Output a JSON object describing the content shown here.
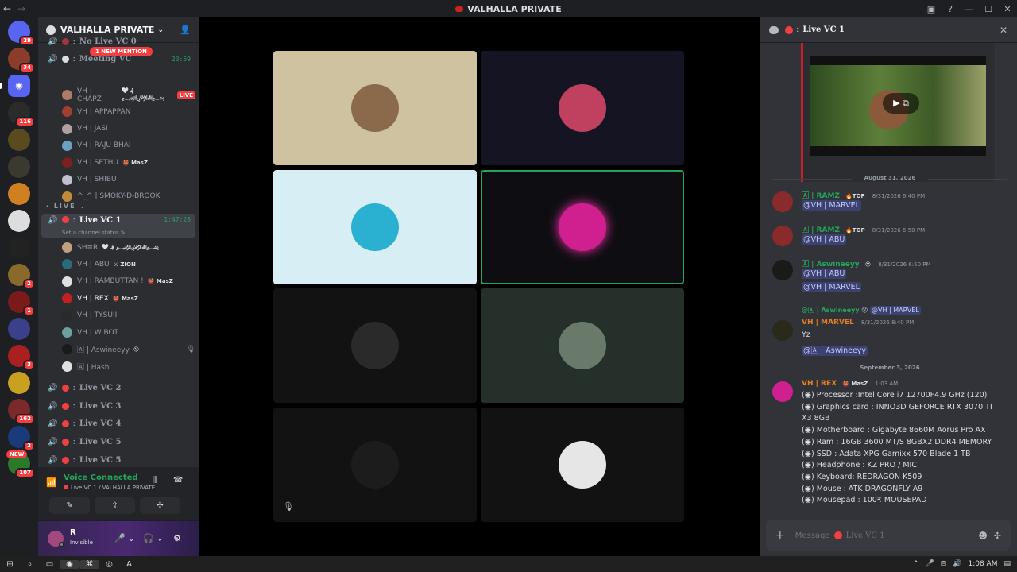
{
  "window": {
    "title": "VALHALLA PRIVATE",
    "back": "←",
    "forward": "→",
    "controls": [
      "▣",
      "?",
      "—",
      "☐",
      "✕"
    ]
  },
  "servers": [
    {
      "name": "discord-home",
      "badge": "29",
      "color": "#5865f2"
    },
    {
      "name": "server-1",
      "badge": "34",
      "color": "#8a3d2a"
    },
    {
      "name": "server-discord",
      "badge": "",
      "color": "#5865f2",
      "selected": true
    },
    {
      "name": "server-3",
      "badge": "116",
      "color": "#2b2b2b"
    },
    {
      "name": "server-4",
      "badge": "",
      "color": "#5a4a20"
    },
    {
      "name": "server-5",
      "badge": "",
      "color": "#3a3a30"
    },
    {
      "name": "server-6",
      "badge": "",
      "color": "#d08020"
    },
    {
      "name": "server-7",
      "badge": "",
      "color": "#ddd"
    },
    {
      "name": "server-8",
      "badge": "",
      "color": "#222"
    },
    {
      "name": "server-9",
      "badge": "2",
      "color": "#8a6a2a"
    },
    {
      "name": "server-10",
      "badge": "1",
      "color": "#7a1a1a"
    },
    {
      "name": "folder",
      "badge": "",
      "color": "#3c3f8a"
    },
    {
      "name": "server-12",
      "badge": "3",
      "color": "#aa2020"
    },
    {
      "name": "server-13",
      "badge": "",
      "color": "#c9a020"
    },
    {
      "name": "server-14",
      "badge": "162",
      "color": "#7a2a2a"
    },
    {
      "name": "server-15",
      "badge": "2",
      "color": "#1a3a7a"
    },
    {
      "name": "server-16",
      "badge": "107",
      "color": "#2a7a2a"
    }
  ],
  "new_tag": "NEW",
  "guild": {
    "name": "VALHALLA PRIVATE",
    "caret": "⌄",
    "invite_icon": "👤"
  },
  "mention_pill": "1 NEW MENTION",
  "channels_top": [
    {
      "name": "No Live VC 0",
      "y": -10
    },
    {
      "name": "Meeting VC",
      "time": "23:59",
      "y": 12
    }
  ],
  "meeting_users": [
    {
      "name": "VH | CHAPZ",
      "tag": "🤍 ؋ ﷽",
      "live": "LIVE",
      "color": "#b07a6a"
    },
    {
      "name": "VH | APPAPPAN",
      "tag": "",
      "color": "#a04030"
    },
    {
      "name": "VH | JASI",
      "tag": "",
      "color": "#b0a0a0"
    },
    {
      "name": "VH | RAJU BHAI",
      "tag": "",
      "color": "#6aa0c0"
    },
    {
      "name": "VH | SETHU",
      "tag": "👹 MasZ",
      "color": "#7a2020"
    },
    {
      "name": "VH | SHIBU",
      "tag": "",
      "color": "#c0c0d0"
    },
    {
      "name": "^_^ | SMOKY-D-BROOK",
      "tag": "",
      "color": "#c08a3a"
    }
  ],
  "live_category": "LIVE",
  "live_channel": {
    "name": "Live VC 1",
    "time": "1:47:28",
    "status": "Set a channel status ✎"
  },
  "live_users": [
    {
      "name": "SH≡R",
      "tag": "🤍 ؋ ﷽",
      "color": "#c0a080",
      "bright": false
    },
    {
      "name": "VH | ABU",
      "tag": "⚔ ZION",
      "color": "#2a6a7a",
      "bright": false
    },
    {
      "name": "VH | RAMBUTTAN !",
      "tag": "👹 MasZ",
      "color": "#e0e0e0",
      "bright": false
    },
    {
      "name": "VH | REX",
      "tag": "👹 MasZ",
      "color": "#c02020",
      "bright": true
    },
    {
      "name": "VH | TYSUII",
      "tag": "",
      "color": "#2a2a2a",
      "bright": false
    },
    {
      "name": "VH | W BOT",
      "tag": "",
      "color": "#6aa0a0",
      "bright": false
    },
    {
      "name": "🄰 | Aswineeyy",
      "tag": "😵",
      "mute": "🎙",
      "color": "#1a1a1a",
      "bright": false
    },
    {
      "name": "🄰 | Hash",
      "tag": "",
      "color": "#e0e0e0",
      "bright": false
    }
  ],
  "other_channels": [
    "Live VC 2",
    "Live VC 3",
    "Live VC 4",
    "Live VC 5",
    "Live VC 5"
  ],
  "voice_panel": {
    "title": "Voice Connected",
    "subtitle": "Live VC 1 / VALHALLA PRIVATE",
    "signal_icon": "📶",
    "noise_icon": "⫼",
    "disconnect_icon": "☎",
    "buttons": [
      "✎",
      "⇪",
      "✣",
      "✧"
    ]
  },
  "user": {
    "name": "R",
    "status": "Invisible",
    "mic": "🎤",
    "headset": "🎧",
    "settings": "⚙"
  },
  "stage_tiles": [
    {
      "name": "tile-chapz",
      "bg": "#cfc2a0",
      "avatar": "#8a6a4a"
    },
    {
      "name": "tile-fangs",
      "bg": "#141422",
      "avatar": "#c04060"
    },
    {
      "name": "tile-anime",
      "bg": "#d8eef5",
      "avatar": "#2ab0d0"
    },
    {
      "name": "tile-rex",
      "bg": "#0e0e12",
      "avatar": "#d02090",
      "speaking": true
    },
    {
      "name": "tile-couple",
      "bg": "#121212",
      "avatar": "#2a2a2a"
    },
    {
      "name": "tile-joker",
      "bg": "#25302b",
      "avatar": "#6a7a6a"
    },
    {
      "name": "tile-dark",
      "bg": "#121212",
      "avatar": "#1c1c1c"
    },
    {
      "name": "tile-hash",
      "bg": "#121212",
      "avatar": "#e6e6e6"
    }
  ],
  "stage_mute_icon": "🎙",
  "chat": {
    "channel": "Live VC 1",
    "date_1": "August 31, 2026",
    "date_2": "September 3, 2026",
    "messages": [
      {
        "author": "🄰 | RAMZ",
        "author_color": "#23a55a",
        "tag": "🔥TOP",
        "time": "8/31/2026 6:40 PM",
        "lines": [
          "@VH | MARVEL"
        ],
        "mention": true
      },
      {
        "author": "🄰 | RAMZ",
        "author_color": "#23a55a",
        "tag": "🔥TOP",
        "time": "8/31/2026 6:50 PM",
        "lines": [
          "@VH | ABU"
        ],
        "mention": true
      },
      {
        "author": "🄰 | Aswineeyy",
        "author_color": "#23a55a",
        "tag": "😵",
        "time": "8/31/2026 6:50 PM",
        "lines": [
          "@VH | ABU",
          "@VH | MARVEL"
        ],
        "mention": true
      }
    ],
    "reply": {
      "author": "@🄰 | Aswineeyy",
      "tag": "😵",
      "target": "@VH | MARVEL"
    },
    "marvel_msg": {
      "author": "VH | MARVEL",
      "time": "8/31/2026 8:40 PM",
      "line1": "Yz",
      "line2": "@🄰 | Aswineeyy"
    },
    "rex_msg": {
      "author": "VH | REX",
      "tag": "👹 MasZ",
      "time": "1:03 AM",
      "lines": [
        "(◉) Processor :Intel Core i7 12700F4.9 GHz (120)",
        "(◉) Graphics card :  INNO3D GEFORCE RTX 3070 TI",
        "X3 8GB",
        "(◉) Motherboard : Gigabyte 8660M Aorus Pro AX",
        "(◉) Ram : 16GB 3600 MT/S 8GBX2 DDR4 MEMORY",
        "(◉) SSD : Adata XPG Gamixx 570 Blade 1 TB",
        "(◉) Headphone : KZ PRO / MIC",
        "(◉) Keyboard:  REDRAGON K509",
        "(◉) Mouse :  ATK DRAGONFLY A9",
        "(◉) Mousepad : 100₹ MOUSEPAD"
      ]
    },
    "composer_placeholder": "Message",
    "composer_plus": "+",
    "emoji_icon": "☻",
    "apps_icon": "✣",
    "close_icon": "✕"
  },
  "taskbar": {
    "icons": [
      "⊞",
      "⌕",
      "▭",
      "◉",
      "⌘",
      "◎",
      "A"
    ],
    "tray": [
      "⌃",
      "🎤",
      "⊟",
      "🔊"
    ],
    "clock": "1:08 AM"
  }
}
